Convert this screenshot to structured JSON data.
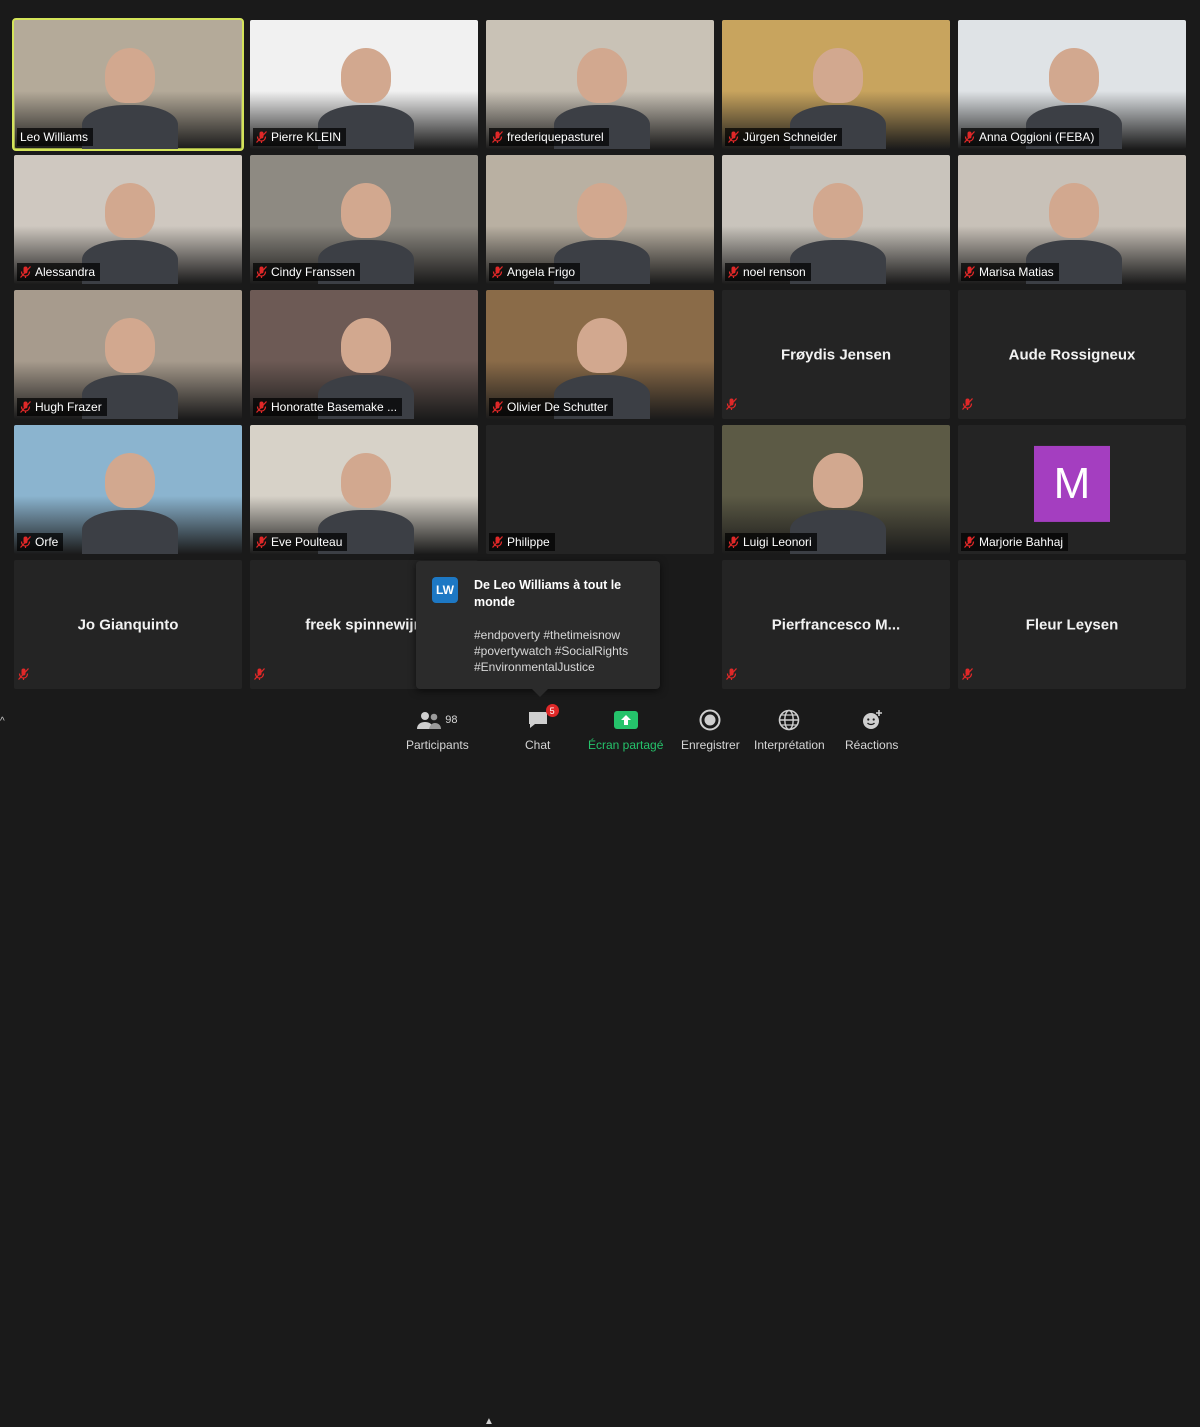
{
  "participants": [
    {
      "name": "Leo Williams",
      "muted": false,
      "active": true,
      "bg": "#b4aa99"
    },
    {
      "name": "Pierre KLEIN",
      "muted": true,
      "bg": "#f1f1f1"
    },
    {
      "name": "frederiquepasturel",
      "muted": true,
      "bg": "#c9c2b6"
    },
    {
      "name": "Jürgen Schneider",
      "muted": true,
      "bg": "#c8a45e"
    },
    {
      "name": "Anna Oggioni (FEBA)",
      "muted": true,
      "bg": "#dfe3e6"
    },
    {
      "name": "Alessandra",
      "muted": true,
      "bg": "#cfc8c0"
    },
    {
      "name": "Cindy Franssen",
      "muted": true,
      "bg": "#8e8a82"
    },
    {
      "name": "Angela Frigo",
      "muted": true,
      "bg": "#b9b0a2"
    },
    {
      "name": "noel renson",
      "muted": true,
      "bg": "#c9c4bc"
    },
    {
      "name": "Marisa Matias",
      "muted": true,
      "bg": "#c8c1b8"
    },
    {
      "name": "Hugh Frazer",
      "muted": true,
      "bg": "#a79b8d"
    },
    {
      "name": "Honoratte Basemake ...",
      "muted": true,
      "bg": "#6d5a55"
    },
    {
      "name": "Olivier De Schutter",
      "muted": true,
      "bg": "#8a6b48"
    },
    {
      "name": "Frøydis Jensen",
      "muted": true,
      "centered": true
    },
    {
      "name": "Aude Rossigneux",
      "muted": true,
      "centered": true
    },
    {
      "name": "Orfe",
      "muted": true,
      "bg": "#8bb4cf"
    },
    {
      "name": "Eve Poulteau",
      "muted": true,
      "bg": "#d7d2c8"
    },
    {
      "name": "Philippe",
      "muted": true,
      "bg": "#242424"
    },
    {
      "name": "Luigi Leonori",
      "muted": true,
      "bg": "#5c5a45"
    },
    {
      "name": "Marjorie Bahhaj",
      "muted": true,
      "avatar": "M"
    },
    {
      "name": "Jo Gianquinto",
      "muted": true,
      "centered": true
    },
    {
      "name": "freek spinnewijn",
      "muted": true,
      "centered": true
    },
    {
      "name": "",
      "muted": false,
      "hidden": true
    },
    {
      "name": "Pierfrancesco M...",
      "muted": true,
      "centered": true
    },
    {
      "name": "Fleur Leysen",
      "muted": true,
      "centered": true
    }
  ],
  "chat_popup": {
    "initials": "LW",
    "from": "De Leo Williams à tout le monde",
    "message": "#endpoverty #thetimeisnow #povertywatch #SocialRights #EnvironmentalJustice"
  },
  "toolbar": {
    "participants_label": "Participants",
    "participants_count": "98",
    "chat_label": "Chat",
    "chat_badge": "5",
    "share_label": "Écran partagé",
    "record_label": "Enregistrer",
    "interpretation_label": "Interprétation",
    "reactions_label": "Réactions"
  },
  "colors": {
    "active_speaker": "#d4e45a",
    "share_green": "#25c36b",
    "muted_red": "#e02828",
    "avatar_purple": "#a43ec0"
  }
}
